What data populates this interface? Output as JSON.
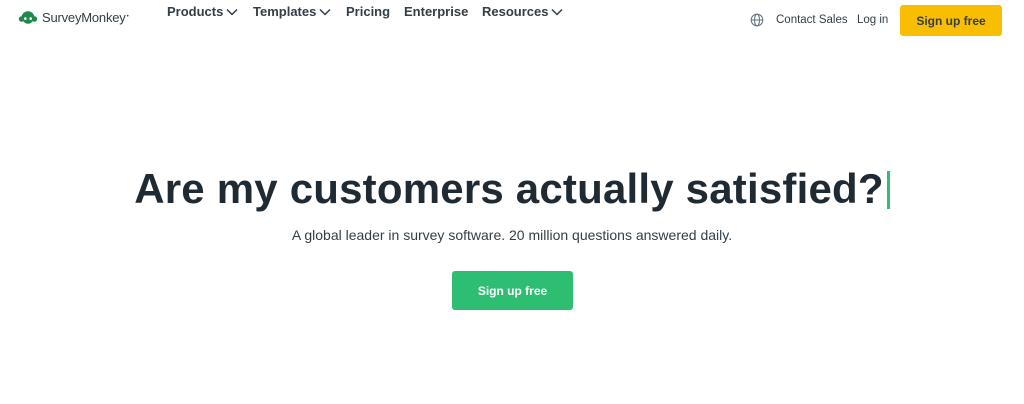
{
  "brand": {
    "name": "SurveyMonkey",
    "logo_icon": "surveymonkey-logo-icon",
    "accent_green": "#2dbe72",
    "accent_yellow": "#f9be00"
  },
  "nav": {
    "items": [
      {
        "label": "Products",
        "has_dropdown": true
      },
      {
        "label": "Templates",
        "has_dropdown": true
      },
      {
        "label": "Pricing",
        "has_dropdown": false
      },
      {
        "label": "Enterprise",
        "has_dropdown": false
      },
      {
        "label": "Resources",
        "has_dropdown": true
      }
    ],
    "globe_icon": "globe-icon",
    "contact_sales": "Contact Sales",
    "login": "Log in",
    "signup": "Sign up free"
  },
  "hero": {
    "title": "Are my customers actually satisfied?",
    "subtitle": "A global leader in survey software. 20 million questions answered daily.",
    "cta": "Sign up free"
  }
}
